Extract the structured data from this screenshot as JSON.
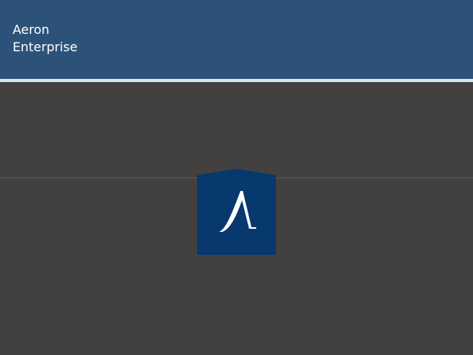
{
  "app": {
    "title_line1": "Aeron",
    "title_line2": "Enterprise"
  },
  "logo": {
    "icon": "aeron-logo-icon",
    "glyph": "Λ"
  },
  "colors": {
    "header_bg": "#2c5279",
    "header_accent": "#cfe9ec",
    "body_bg": "#424140",
    "logo_bg": "#07386e",
    "logo_glyph": "#ffffff"
  }
}
